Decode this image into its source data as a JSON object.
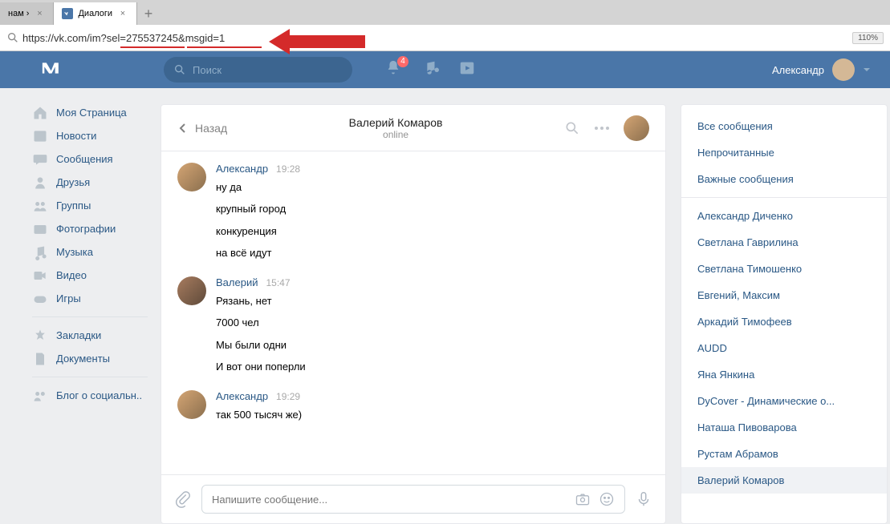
{
  "browser": {
    "tabs": [
      {
        "title": "нам ›",
        "active": false
      },
      {
        "title": "Диалоги",
        "active": true
      }
    ],
    "url": "https://vk.com/im?sel=275537245&msgid=1",
    "zoom": "110%"
  },
  "header": {
    "search_placeholder": "Поиск",
    "notification_count": "4",
    "user_name": "Александр"
  },
  "left_nav": [
    {
      "icon": "home",
      "label": "Моя Страница"
    },
    {
      "icon": "news",
      "label": "Новости"
    },
    {
      "icon": "messages",
      "label": "Сообщения"
    },
    {
      "icon": "friends",
      "label": "Друзья"
    },
    {
      "icon": "groups",
      "label": "Группы"
    },
    {
      "icon": "photos",
      "label": "Фотографии"
    },
    {
      "icon": "music",
      "label": "Музыка"
    },
    {
      "icon": "video",
      "label": "Видео"
    },
    {
      "icon": "games",
      "label": "Игры"
    }
  ],
  "left_nav_secondary": [
    {
      "icon": "bookmark",
      "label": "Закладки"
    },
    {
      "icon": "doc",
      "label": "Документы"
    }
  ],
  "left_nav_tertiary": [
    {
      "icon": "blog",
      "label": "Блог о социальн.."
    }
  ],
  "dialog": {
    "back_label": "Назад",
    "title": "Валерий Комаров",
    "status": "online",
    "messages": [
      {
        "author": "Александр",
        "time": "19:28",
        "lines": [
          "ну да",
          "крупный город",
          "конкуренция",
          "на всё идут"
        ],
        "avatar": "a1"
      },
      {
        "author": "Валерий",
        "time": "15:47",
        "lines": [
          "Рязань, нет",
          "7000 чел",
          "Мы были одни",
          "И вот они поперли"
        ],
        "avatar": "a2"
      },
      {
        "author": "Александр",
        "time": "19:29",
        "lines": [
          "так 500 тысяч же)"
        ],
        "avatar": "a1"
      }
    ],
    "composer_placeholder": "Напишите сообщение..."
  },
  "right_panel": {
    "filters": [
      "Все сообщения",
      "Непрочитанные",
      "Важные сообщения"
    ],
    "contacts": [
      "Александр Диченко",
      "Светлана Гаврилина",
      "Светлана Тимошенко",
      "Евгений, Максим",
      "Аркадий Тимофеев",
      "AUDD",
      "Яна Янкина",
      "DyCover - Динамические о...",
      "Наташа Пивоварова",
      "Рустам Абрамов",
      "Валерий Комаров"
    ],
    "selected": "Валерий Комаров"
  }
}
